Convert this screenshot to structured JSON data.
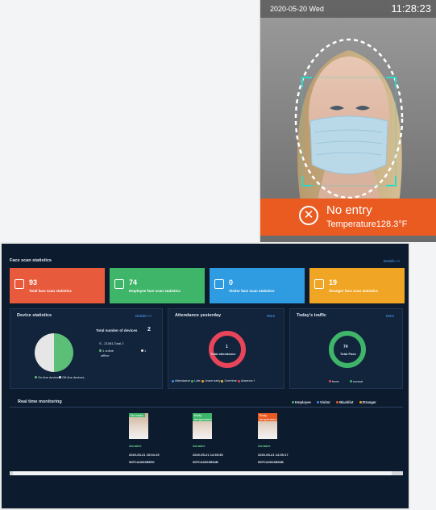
{
  "kiosk": {
    "date": "2020-05-20 Wed",
    "time": "11:28:23",
    "alert_title": "No entry",
    "alert_temperature": "Temperature128.3°F",
    "alert_color": "#ea5b22"
  },
  "dashboard": {
    "face_scan_title": "Face scan statistics",
    "details_link": "Details >>",
    "cards": [
      {
        "count": "93",
        "label": "Total face scan statistics",
        "color": "#e85a3c",
        "icon": "people-icon"
      },
      {
        "count": "74",
        "label": "Employee face scan statistics",
        "color": "#3fb56a",
        "icon": "employee-icon"
      },
      {
        "count": "0",
        "label": "Visitor face scan statistics",
        "color": "#2f9be0",
        "icon": "visitor-icon"
      },
      {
        "count": "19",
        "label": "Stranger face scan statistics",
        "color": "#f0a524",
        "icon": "stranger-icon"
      }
    ],
    "device": {
      "title": "Device statistics",
      "details": "Details >>",
      "total_label": "Total number of devices",
      "total_value": "2",
      "summary": "S - Z1081,Total 2",
      "online": "1 online",
      "offline": "offline",
      "offline_count": "1",
      "legend_online": "On-line devices",
      "legend_offline": "Off-line devices"
    },
    "attendance": {
      "title": "Attendance yesterday",
      "more": "More",
      "center_value": "1",
      "center_label": "Total attendance",
      "legend": [
        {
          "label": "Attendance",
          "color": "#3c8be6"
        },
        {
          "label": "Late",
          "color": "#3fb56a"
        },
        {
          "label": "Leave early",
          "color": "#f0a524"
        },
        {
          "label": "Overtime",
          "color": "#e8c43a"
        },
        {
          "label": "Absence f",
          "color": "#e8455a"
        }
      ]
    },
    "traffic": {
      "title": "Today's traffic",
      "more": "More",
      "center_value": "74",
      "center_label": "Total Pass",
      "legend": [
        {
          "label": "fever",
          "color": "#e8455a"
        },
        {
          "label": "normal",
          "color": "#3fb56a"
        }
      ]
    },
    "realtime": {
      "title": "Real time monitoring",
      "legend": [
        {
          "label": "Employee",
          "color": "#3fb56a"
        },
        {
          "label": "Visitor",
          "color": "#3c8be6"
        },
        {
          "label": "Blacklist",
          "color": "#e8455a"
        },
        {
          "label": "Stranger",
          "color": "#f0a524"
        }
      ],
      "cards": [
        {
          "tag": "No mask",
          "tag_color": "#3fb56a",
          "name": "Annalee",
          "time": "2020-05-21 15:04:19",
          "id": "90FCA0003BE90"
        },
        {
          "tag": "Body temperature",
          "tag_color": "#3fb56a",
          "name": "Annalee",
          "time": "2020-05-21 14:35:35",
          "id": "90FCA0003B54B"
        },
        {
          "tag": "Body temperature",
          "tag_color": "#ea5b22",
          "name": "Annalee",
          "time": "2020-05-21 14:35:17",
          "id": "90FCA0003B54B"
        }
      ]
    }
  },
  "chart_data": [
    {
      "type": "pie",
      "title": "Device statistics",
      "categories": [
        "On-line devices",
        "Off-line devices"
      ],
      "values": [
        1,
        1
      ],
      "colors": [
        "#5cbf78",
        "#e6e6e6"
      ]
    },
    {
      "type": "pie",
      "title": "Attendance yesterday",
      "categories": [
        "Absence f"
      ],
      "values": [
        1
      ],
      "colors": [
        "#e8455a"
      ]
    },
    {
      "type": "pie",
      "title": "Today's traffic",
      "categories": [
        "normal"
      ],
      "values": [
        74
      ],
      "colors": [
        "#3fb56a"
      ]
    }
  ]
}
